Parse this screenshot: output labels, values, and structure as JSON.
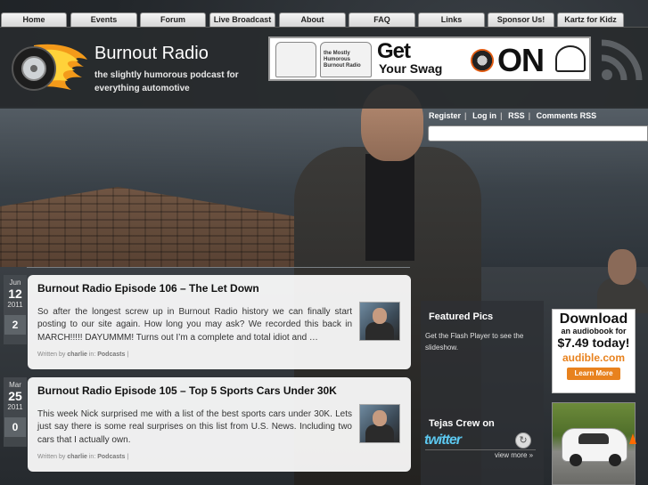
{
  "nav": {
    "items": [
      "Home",
      "Events",
      "Forum",
      "Live Broadcast",
      "About",
      "FAQ",
      "Links",
      "Sponsor Us!",
      "Kartz for Kidz"
    ]
  },
  "header": {
    "title": "Burnout Radio",
    "tagline": "the slightly humorous podcast for everything automotive",
    "banner": {
      "line1": "Get",
      "line2": "Your Swag",
      "line3": "ON",
      "shirt_text": "the Mostly Humorous Burnout Radio"
    },
    "logo_icon": "flaming-tire-logo",
    "rss_icon": "rss-feed-icon"
  },
  "toplinks": {
    "items": [
      "Register",
      "Log in",
      "RSS",
      "Comments RSS"
    ]
  },
  "search": {
    "placeholder": ""
  },
  "posts": [
    {
      "month": "Jun",
      "day": "12",
      "year": "2011",
      "comments": "2",
      "title": "Burnout Radio Episode 106 – The Let Down",
      "excerpt": "So after the longest screw up in Burnout Radio history we can finally start posting to our site again. How long you may ask? We recorded this back in MARCH!!!!! DAYUMMM! Turns out I’m a complete and total idiot and …",
      "meta_prefix": "Written by",
      "author": "charlie",
      "meta_in": "in:",
      "category": "Podcasts",
      "meta_sep": "|"
    },
    {
      "month": "Mar",
      "day": "25",
      "year": "2011",
      "comments": "0",
      "title": "Burnout Radio Episode 105 – Top 5 Sports Cars Under 30K",
      "excerpt": "This week Nick surprised me with a list of the best sports cars under 30K. Lets just say there is some real surprises on this list from U.S. News. Including two cars that I actually own.",
      "meta_prefix": "Written by",
      "author": "charlie",
      "meta_in": "in:",
      "category": "Podcasts",
      "meta_sep": "|"
    }
  ],
  "sidebar": {
    "featured_title": "Featured Pics",
    "flash_note": "Get the Flash Player to see the slideshow.",
    "twitter_title": "Tejas Crew on",
    "twitter_logo": "twitter",
    "view_more": "view more »"
  },
  "ads": {
    "audible": {
      "line1": "Download",
      "line2": "an audiobook for",
      "line3": "$7.49 today!",
      "brand": "audible.com",
      "button": "Learn More"
    }
  },
  "colors": {
    "nav_bg": "#e6e6e6",
    "header_bg": "#2b2e31",
    "twitter_blue": "#5cc8f0",
    "audible_orange": "#e8821e"
  }
}
